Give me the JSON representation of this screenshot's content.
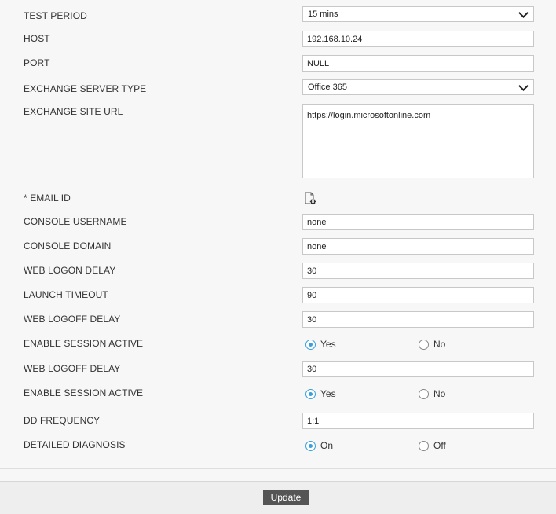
{
  "form": {
    "test_period": {
      "label": "TEST PERIOD",
      "value": "15 mins"
    },
    "host": {
      "label": "HOST",
      "value": "192.168.10.24"
    },
    "port": {
      "label": "PORT",
      "value": "NULL"
    },
    "exchange_server_type": {
      "label": "EXCHANGE SERVER TYPE",
      "value": "Office 365"
    },
    "exchange_site_url": {
      "label": "EXCHANGE SITE URL",
      "value": "https://login.microsoftonline.com"
    },
    "email_id": {
      "label": "* EMAIL ID",
      "icon": "document-gear-icon"
    },
    "console_username": {
      "label": "CONSOLE USERNAME",
      "value": "none"
    },
    "console_domain": {
      "label": "CONSOLE DOMAIN",
      "value": "none"
    },
    "web_logon_delay": {
      "label": "WEB LOGON DELAY",
      "value": "30"
    },
    "launch_timeout": {
      "label": "LAUNCH TIMEOUT",
      "value": "90"
    },
    "web_logoff_delay_1": {
      "label": "WEB LOGOFF DELAY",
      "value": "30"
    },
    "enable_session_active_1": {
      "label": "ENABLE SESSION ACTIVE",
      "options": [
        "Yes",
        "No"
      ],
      "selected": "Yes"
    },
    "web_logoff_delay_2": {
      "label": "WEB LOGOFF DELAY",
      "value": "30"
    },
    "enable_session_active_2": {
      "label": "ENABLE SESSION ACTIVE",
      "options": [
        "Yes",
        "No"
      ],
      "selected": "Yes"
    },
    "dd_frequency": {
      "label": "DD FREQUENCY",
      "value": "1:1"
    },
    "detailed_diagnosis": {
      "label": "DETAILED DIAGNOSIS",
      "options": [
        "On",
        "Off"
      ],
      "selected": "On"
    }
  },
  "footer": {
    "update_label": "Update"
  },
  "colors": {
    "radio_accent": "#3ba0d8",
    "button_bg": "#555555"
  }
}
